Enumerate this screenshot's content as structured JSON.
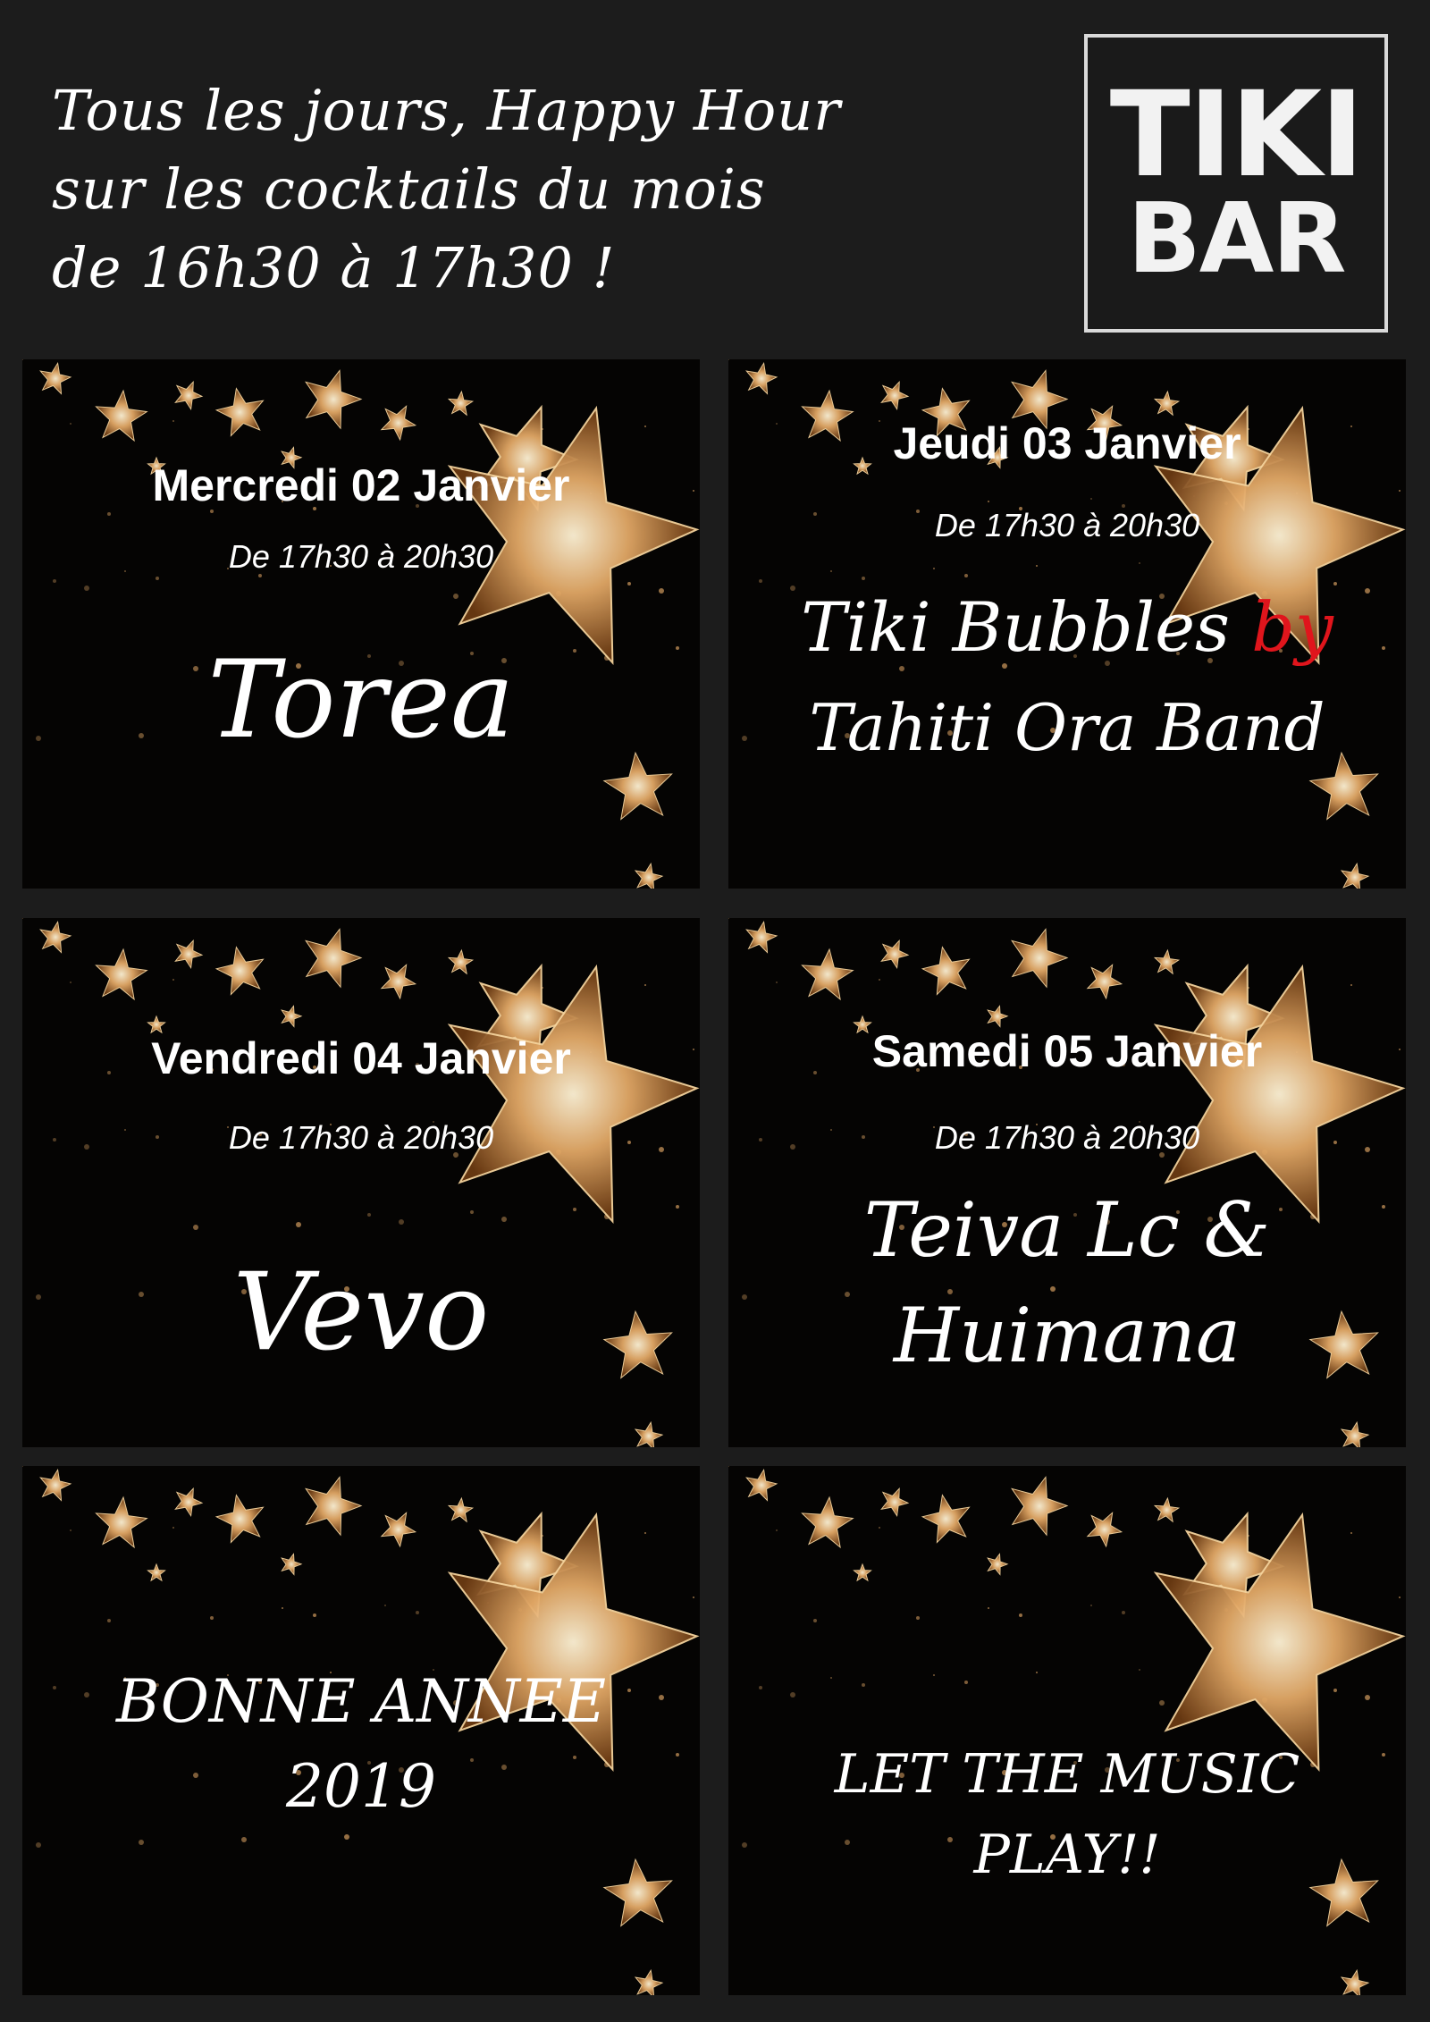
{
  "header": {
    "lines": [
      "Tous les jours, Happy Hour",
      "sur les cocktails du mois",
      "de 16h30 à 17h30 !"
    ]
  },
  "logo": {
    "line1": "TIKI",
    "line2": "BAR"
  },
  "events": [
    {
      "date": "Mercredi 02 Janvier",
      "time": "De 17h30 à 20h30",
      "artist": "Torea"
    },
    {
      "date": "Jeudi 03 Janvier",
      "time": "De 17h30 à 20h30",
      "artist_line1": "Tiki Bubbles",
      "artist_by": "by",
      "artist_line2": "Tahiti Ora Band"
    },
    {
      "date": "Vendredi 04 Janvier",
      "time": "De 17h30 à 20h30",
      "artist": "Vevo"
    },
    {
      "date": "Samedi 05 Janvier",
      "time": "De 17h30 à 20h30",
      "artist_line1": "Teiva Lc &",
      "artist_line2": "Huimana"
    }
  ],
  "greetings": [
    {
      "line1": "BONNE ANNEE",
      "line2": "2019"
    },
    {
      "line1": "LET THE  MUSIC",
      "line2": "PLAY!!"
    }
  ],
  "colors": {
    "background": "#1c1c1c",
    "panel": "#050403",
    "star": "#e2a866",
    "accent_red": "#e0151c"
  }
}
